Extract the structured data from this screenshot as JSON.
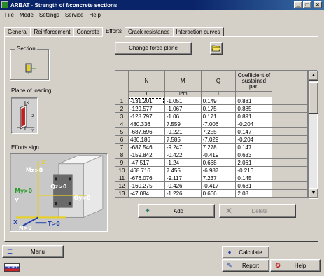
{
  "window": {
    "title": "ARBAT - Strength of f/concrete sections",
    "minimize": "_",
    "maximize": "□",
    "close": "×"
  },
  "menu": [
    "File",
    "Mode",
    "Settings",
    "Service",
    "Help"
  ],
  "tabs": [
    "General",
    "Reinforcement",
    "Concrete",
    "Efforts",
    "Crack resistance",
    "Interaction curves"
  ],
  "active_tab": "Efforts",
  "left_panel": {
    "section_label": "Section",
    "plane_label": "Plane of loading",
    "efforts_label": "Efforts sign",
    "efforts_diagram_labels": {
      "mz": "Mz>0",
      "my": "My>0",
      "qz": "Qz>0",
      "qy": "Qy>0",
      "n": "N>0",
      "t": "T>0",
      "z": "Z",
      "y": "Y",
      "x": "X"
    }
  },
  "change_force_label": "Change force plane",
  "grid": {
    "headers": [
      "N",
      "M",
      "Q",
      "Coefficient of sustained part"
    ],
    "units": [
      "T",
      "T*m",
      "T",
      ""
    ],
    "rows": [
      [
        "1",
        "-131.201",
        "-1.051",
        "0.149",
        "0.881"
      ],
      [
        "2",
        "-129.577",
        "-1.067",
        "0.175",
        "0.885"
      ],
      [
        "3",
        "-128.797",
        "-1.06",
        "0.171",
        "0.891"
      ],
      [
        "4",
        "480.336",
        "7.559",
        "-7.006",
        "-0.204"
      ],
      [
        "5",
        "-687.696",
        "-9.221",
        "7.255",
        "0.147"
      ],
      [
        "6",
        "480.186",
        "7.585",
        "-7.029",
        "-0.204"
      ],
      [
        "7",
        "-687.546",
        "-9.247",
        "7.278",
        "0.147"
      ],
      [
        "8",
        "-159.842",
        "-0.422",
        "-0.419",
        "0.633"
      ],
      [
        "9",
        "-47.517",
        "-1.24",
        "0.668",
        "2.061"
      ],
      [
        "10",
        "468.716",
        "7.455",
        "-6.987",
        "-0.216"
      ],
      [
        "11",
        "-676.076",
        "-9.117",
        "7.237",
        "0.145"
      ],
      [
        "12",
        "-160.275",
        "-0.426",
        "-0.417",
        "0.631"
      ],
      [
        "13",
        "-47.084",
        "-1.226",
        "0.666",
        "2.08"
      ]
    ],
    "scroll_up": "▲",
    "scroll_down": "▼"
  },
  "buttons": {
    "add": "Add",
    "delete": "Delete",
    "menu": "Menu",
    "calculate": "Calculate",
    "report": "Report",
    "help": "Help"
  },
  "flag_text": "SCAD",
  "colors": {
    "titlebar": "#0a246a",
    "face": "#d4d0c8",
    "diagram_green": "#2a9a2a",
    "diagram_blue": "#1e3fb0",
    "diagram_yellow": "#e8d020"
  }
}
